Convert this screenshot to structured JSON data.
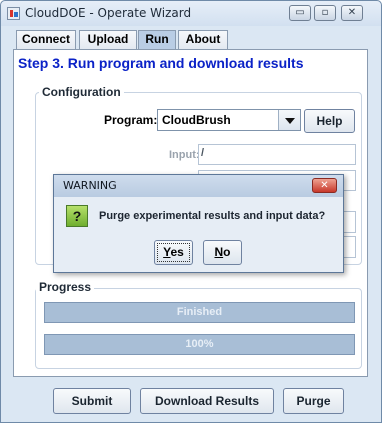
{
  "window": {
    "title": "CloudDOE - Operate Wizard",
    "controls": {
      "minimize": "▭",
      "maximize": "▫",
      "close": "✕"
    }
  },
  "tabs": [
    {
      "label": "Connect",
      "active": false
    },
    {
      "label": "Upload",
      "active": false
    },
    {
      "label": "Run",
      "active": true
    },
    {
      "label": "About",
      "active": false
    }
  ],
  "step_title": "Step 3. Run program and download results",
  "configuration": {
    "label": "Configuration",
    "program_label": "Program:",
    "program_value": "CloudBrush",
    "help_label": "Help",
    "input_label": "Input:",
    "input_value": "/"
  },
  "progress": {
    "label": "Progress",
    "status_text": "Finished",
    "percent_text": "100%",
    "percent": 100
  },
  "buttons": {
    "submit": "Submit",
    "download": "Download Results",
    "purge": "Purge"
  },
  "dialog": {
    "title": "WARNING",
    "icon_glyph": "?",
    "message": "Purge experimental results and input data?",
    "yes_label": "Yes",
    "yes_mnemonic": "Y",
    "yes_rest": "es",
    "no_label": "No",
    "no_mnemonic": "N",
    "no_rest": "o",
    "close_glyph": "✕"
  },
  "colors": {
    "step_title": "#0b22c7",
    "progress_bar": "#a8bed6",
    "tab_active": "#b9cde5",
    "dialog_close": "#c7382a",
    "question_icon": "#6fae2e"
  }
}
